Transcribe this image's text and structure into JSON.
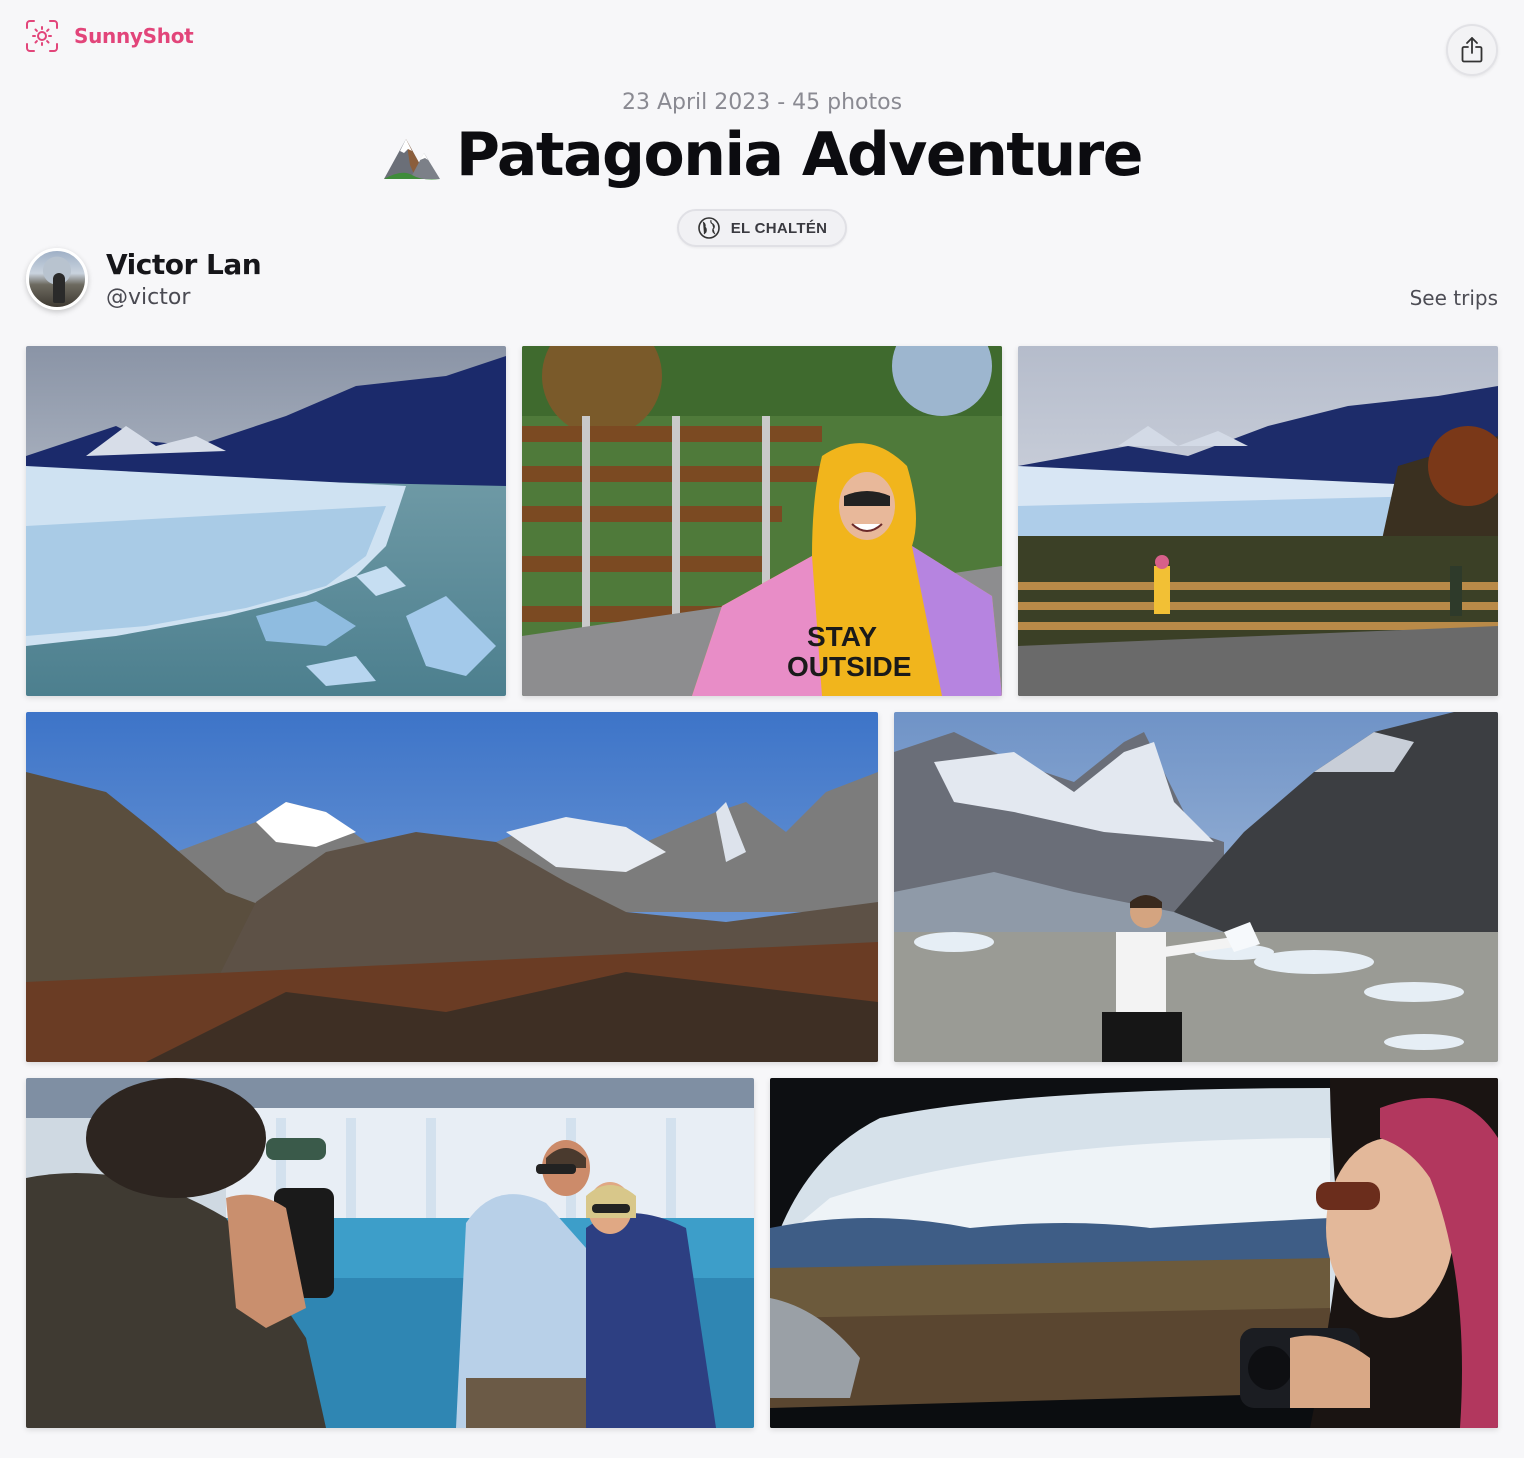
{
  "brand": {
    "name": "SunnyShot",
    "logo_icon": "sun-camera-icon",
    "accent": "#e2457a"
  },
  "header": {
    "share_icon": "share-icon"
  },
  "trip": {
    "meta": "23 April 2023 - 45 photos",
    "title": "Patagonia Adventure",
    "emoji": "mountain-emoji",
    "location": "EL CHALTÉN",
    "location_icon": "globe-icon"
  },
  "author": {
    "name": "Victor Lan",
    "handle": "@victor",
    "see_trips": "See trips"
  },
  "photos": [
    {
      "subject": "glacier-wide"
    },
    {
      "subject": "woman-yellow-hoodie"
    },
    {
      "subject": "glacier-boardwalk"
    },
    {
      "subject": "mountain-range"
    },
    {
      "subject": "man-with-ice"
    },
    {
      "subject": "couple-at-glacier"
    },
    {
      "subject": "car-window-view"
    }
  ]
}
